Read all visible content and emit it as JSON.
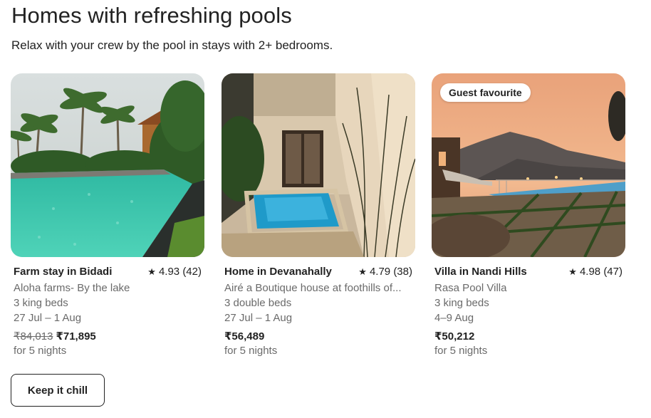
{
  "section": {
    "title": "Homes with refreshing pools",
    "subtitle": "Relax with your crew by the pool in stays with 2+ bedrooms."
  },
  "listings": [
    {
      "title": "Farm stay in Bidadi",
      "rating": "4.93 (42)",
      "host": "Aloha farms- By the lake",
      "beds": "3 king beds",
      "dates": "27 Jul – 1 Aug",
      "original_price": "₹84,013",
      "price": "₹71,895",
      "nights": "for 5 nights",
      "badge": ""
    },
    {
      "title": "Home in Devanahally",
      "rating": "4.79 (38)",
      "host": "Airé a Boutique house at foothills of...",
      "beds": "3 double beds",
      "dates": "27 Jul – 1 Aug",
      "original_price": "",
      "price": "₹56,489",
      "nights": "for 5 nights",
      "badge": ""
    },
    {
      "title": "Villa in Nandi Hills",
      "rating": "4.98 (47)",
      "host": "Rasa Pool Villa",
      "beds": "3 king beds",
      "dates": "4–9 Aug",
      "original_price": "",
      "price": "₹50,212",
      "nights": "for 5 nights",
      "badge": "Guest favourite"
    }
  ],
  "cta": {
    "label": "Keep it chill"
  },
  "icons": {
    "rating": "star-icon"
  }
}
